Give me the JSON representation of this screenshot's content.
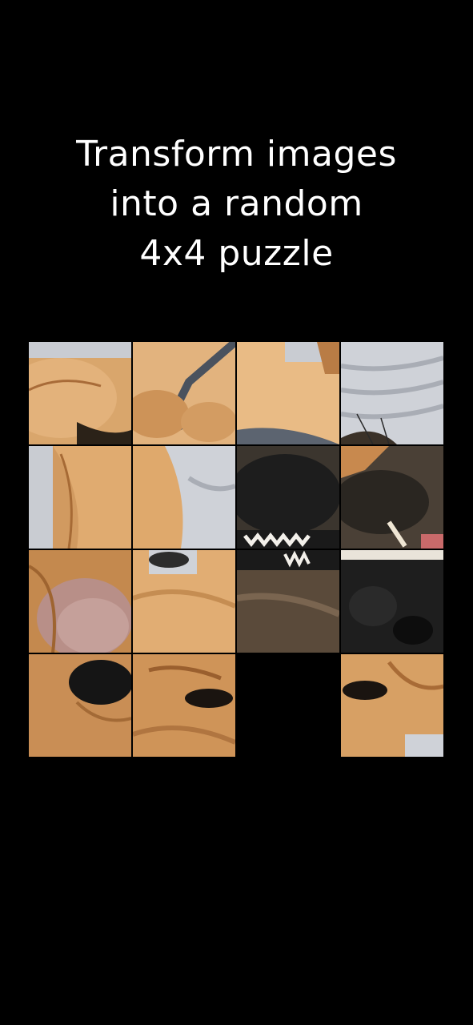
{
  "headline": {
    "line1": "Transform images",
    "line2": "into a random",
    "line3": "4x4 puzzle"
  },
  "puzzle": {
    "grid_size": "4x4",
    "empty_tile": {
      "row": 4,
      "col": 3
    },
    "tiles": [
      {
        "row": 1,
        "col": 1,
        "content": "dog ear and fur"
      },
      {
        "row": 1,
        "col": 2,
        "content": "dog collar"
      },
      {
        "row": 1,
        "col": 3,
        "content": "dog fur close-up"
      },
      {
        "row": 1,
        "col": 4,
        "content": "grey blanket and whiskers"
      },
      {
        "row": 2,
        "col": 1,
        "content": "dog ear fold"
      },
      {
        "row": 2,
        "col": 2,
        "content": "dog cheek with blanket"
      },
      {
        "row": 2,
        "col": 3,
        "content": "dog nose and teeth"
      },
      {
        "row": 2,
        "col": 4,
        "content": "dog muzzle with teeth"
      },
      {
        "row": 3,
        "col": 1,
        "content": "inner ear pink"
      },
      {
        "row": 3,
        "col": 2,
        "content": "dog chin fur"
      },
      {
        "row": 3,
        "col": 3,
        "content": "dog mouth and teeth"
      },
      {
        "row": 3,
        "col": 4,
        "content": "dog nose close-up"
      },
      {
        "row": 4,
        "col": 1,
        "content": "dog nose tip"
      },
      {
        "row": 4,
        "col": 2,
        "content": "dog eye"
      },
      {
        "row": 4,
        "col": 4,
        "content": "dog eye and fur"
      }
    ]
  },
  "colors": {
    "background": "#000000",
    "text": "#ffffff",
    "fur_light": "#e0b07a",
    "fur_dark": "#b97c45",
    "nose": "#1c1c1c",
    "blanket": "#c9ccd2"
  }
}
